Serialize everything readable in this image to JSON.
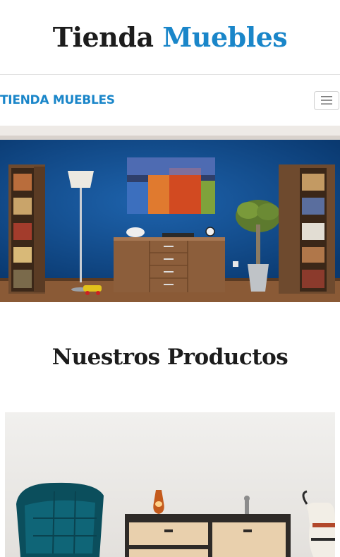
{
  "header": {
    "title_part1": "Tienda",
    "title_part2": "Muebles"
  },
  "navbar": {
    "brand": "TIENDA MUEBLES",
    "toggler_icon": "hamburger-menu-icon"
  },
  "hero": {
    "image": "living-room-blue-wall-illustration"
  },
  "products": {
    "heading": "Nuestros Productos",
    "card_image": "furniture-teal-chair-sideboard-illustration"
  },
  "colors": {
    "accent": "#1a86c9",
    "text": "#1c1c1c",
    "wall_blue": "#0f4f94"
  }
}
